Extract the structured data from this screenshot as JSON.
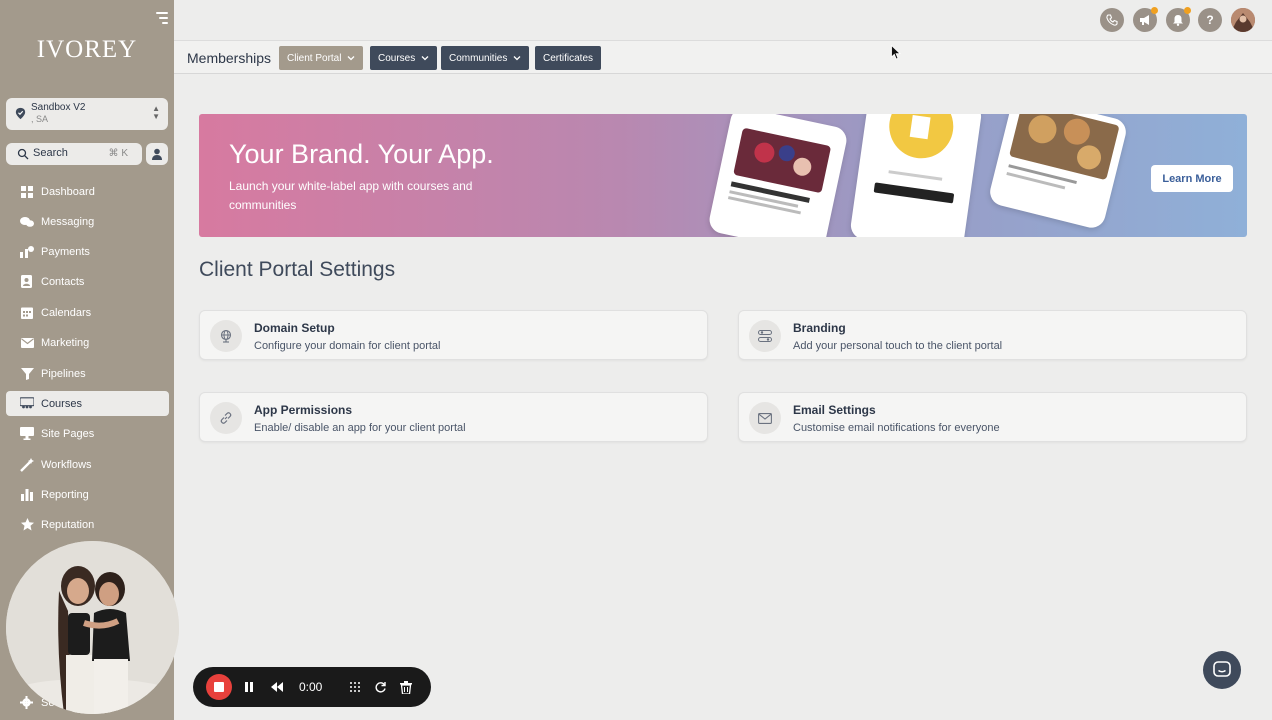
{
  "sidebar": {
    "logo": "IVOREY",
    "location": {
      "name": "Sandbox V2",
      "sub": ", SA"
    },
    "search": {
      "placeholder": "Search",
      "shortcut": "⌘ K"
    },
    "items": [
      {
        "label": "Dashboard",
        "icon": "dashboard-icon"
      },
      {
        "label": "Messaging",
        "icon": "chat-bubbles-icon"
      },
      {
        "label": "Payments",
        "icon": "payments-icon"
      },
      {
        "label": "Contacts",
        "icon": "contact-book-icon"
      },
      {
        "label": "Calendars",
        "icon": "calendar-icon"
      },
      {
        "label": "Marketing",
        "icon": "envelope-icon"
      },
      {
        "label": "Pipelines",
        "icon": "funnel-icon"
      },
      {
        "label": "Courses",
        "icon": "courses-icon",
        "active": true
      },
      {
        "label": "Site Pages",
        "icon": "monitor-icon"
      },
      {
        "label": "Workflows",
        "icon": "magic-wand-icon"
      },
      {
        "label": "Reporting",
        "icon": "bar-chart-icon"
      },
      {
        "label": "Reputation",
        "icon": "star-icon"
      }
    ],
    "settings_label": "Se"
  },
  "header": {
    "title": "Memberships",
    "tabs": [
      {
        "label": "Client Portal",
        "dropdown": true,
        "selected": true
      },
      {
        "label": "Courses",
        "dropdown": true
      },
      {
        "label": "Communities",
        "dropdown": true
      },
      {
        "label": "Certificates",
        "dropdown": false
      }
    ],
    "top_icons": [
      "phone-icon",
      "megaphone-icon",
      "bell-icon",
      "help-icon",
      "avatar"
    ]
  },
  "banner": {
    "heading": "Your Brand. Your App.",
    "text": "Launch your white-label app with courses and communities",
    "button": "Learn More"
  },
  "settings": {
    "title": "Client Portal Settings",
    "cards": [
      {
        "title": "Domain Setup",
        "desc": "Configure your domain for client portal",
        "icon": "globe-icon"
      },
      {
        "title": "Branding",
        "desc": "Add your personal touch to the client portal",
        "icon": "sliders-icon"
      },
      {
        "title": "App Permissions",
        "desc": "Enable/ disable an app for your client portal",
        "icon": "link-icon"
      },
      {
        "title": "Email Settings",
        "desc": "Customise email notifications for everyone",
        "icon": "envelope-icon"
      }
    ]
  },
  "recorder": {
    "time": "0:00"
  },
  "colors": {
    "sidebar": "#a39a8c",
    "tab_dark": "#3f4a5b",
    "record_red": "#e8413c",
    "notification_dot": "#f0a020"
  }
}
